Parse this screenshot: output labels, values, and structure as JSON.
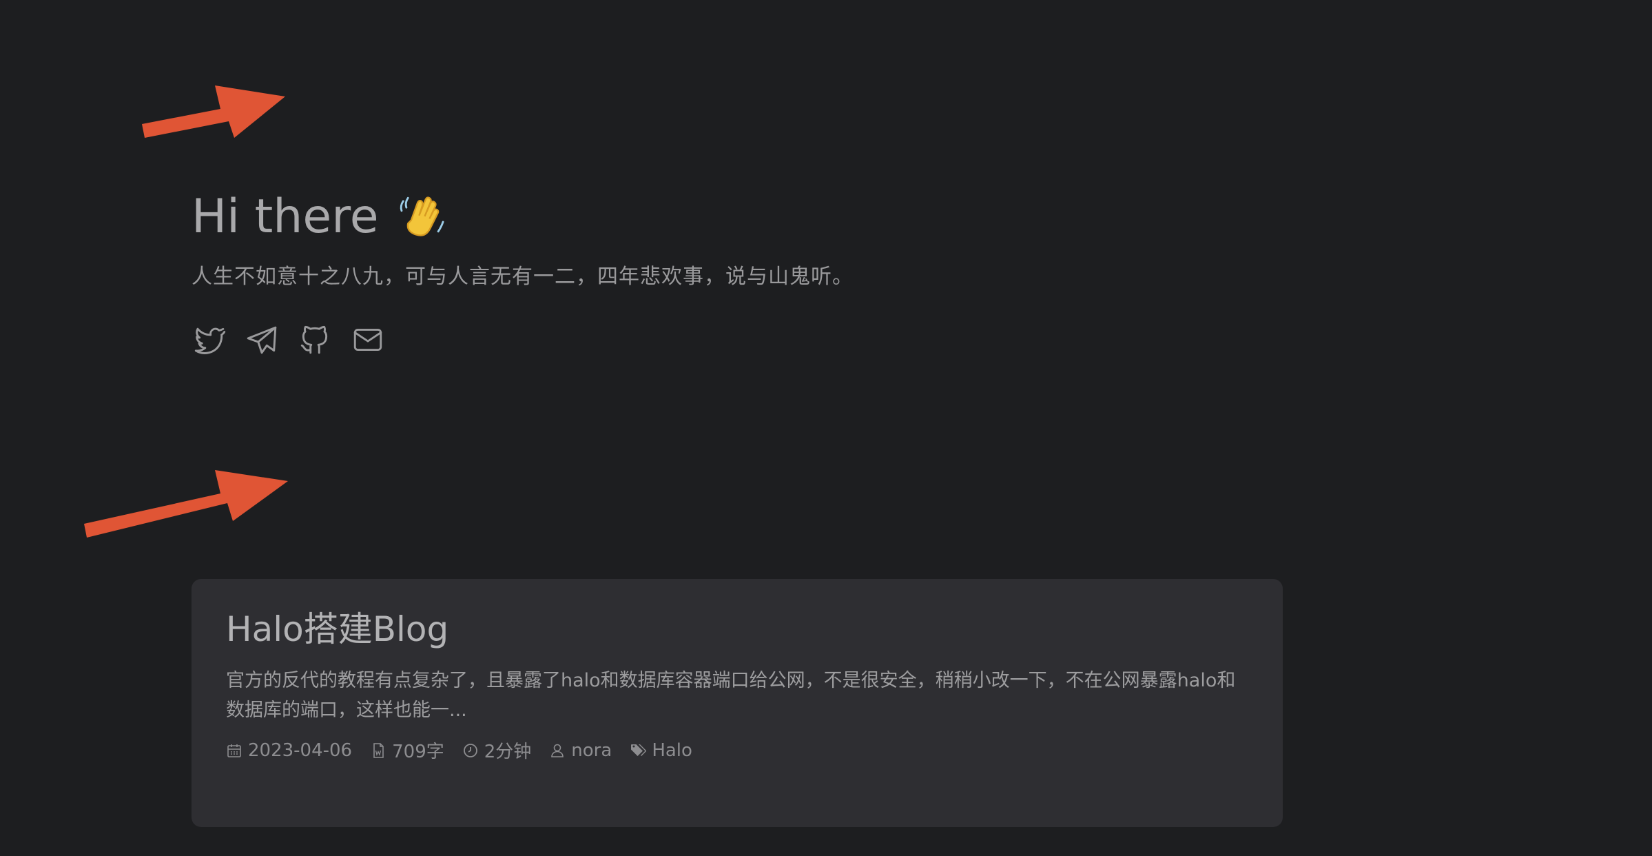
{
  "hero": {
    "title": "Hi there",
    "wave_emoji": "👋",
    "subtitle": "人生不如意十之八九，可与人言无有一二，四年悲欢事，说与山鬼听。"
  },
  "socials": [
    {
      "name": "twitter-icon"
    },
    {
      "name": "telegram-icon"
    },
    {
      "name": "github-icon"
    },
    {
      "name": "mail-icon"
    }
  ],
  "post": {
    "title": "Halo搭建Blog",
    "excerpt": "官方的反代的教程有点复杂了，且暴露了halo和数据库容器端口给公网，不是很安全，稍稍小改一下，不在公网暴露halo和数据库的端口，这样也能一...",
    "date": "2023-04-06",
    "words": "709字",
    "read_time": "2分钟",
    "author": "nora",
    "tag": "Halo"
  },
  "colors": {
    "background": "#1d1e20",
    "card": "#2e2e32",
    "arrow": "#e05535",
    "text": "#a9a9ab"
  }
}
